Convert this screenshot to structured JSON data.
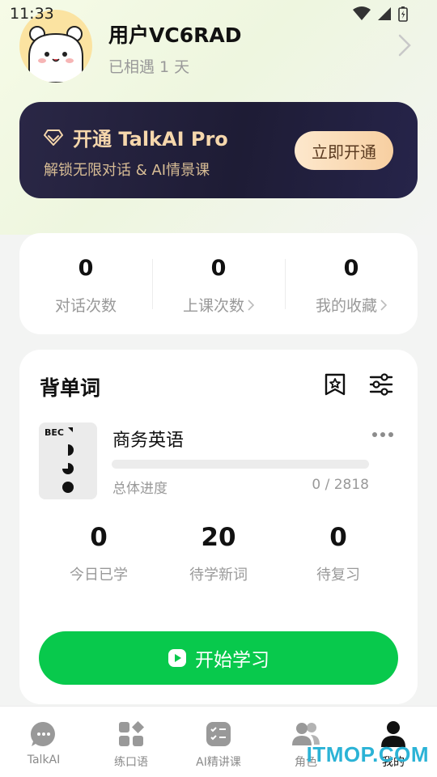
{
  "status_bar": {
    "time": "11:33"
  },
  "profile": {
    "username": "用户VC6RAD",
    "met_days": "已相遇 1 天"
  },
  "pro_card": {
    "title": "开通 TalkAI Pro",
    "subtitle": "解锁无限对话 & AI情景课",
    "button": "立即开通"
  },
  "stats": [
    {
      "value": "0",
      "label": "对话次数",
      "has_chevron": false
    },
    {
      "value": "0",
      "label": "上课次数",
      "has_chevron": true
    },
    {
      "value": "0",
      "label": "我的收藏",
      "has_chevron": true
    }
  ],
  "vocab": {
    "title": "背单词",
    "book": {
      "badge": "BEC",
      "name": "商务英语"
    },
    "progress": {
      "label": "总体进度",
      "learned": 0,
      "total": 2818,
      "text": "0 / 2818",
      "fraction": 0
    },
    "stats": [
      {
        "value": "0",
        "label": "今日已学"
      },
      {
        "value": "20",
        "label": "待学新词"
      },
      {
        "value": "0",
        "label": "待复习"
      }
    ],
    "start_button": "开始学习"
  },
  "tabs": [
    {
      "label": "TalkAI",
      "icon": "chat-bubble-icon"
    },
    {
      "label": "练口语",
      "icon": "grid-icon"
    },
    {
      "label": "AI精讲课",
      "icon": "checklist-icon"
    },
    {
      "label": "角色",
      "icon": "users-icon"
    },
    {
      "label": "我的",
      "icon": "user-icon",
      "active": true
    }
  ],
  "watermark": "ITMOP.COM",
  "colors": {
    "accent": "#08c94c",
    "pro_bg": "#1e1c35",
    "pro_gold": "#f6d7ac",
    "watermark": "#2bb3d6"
  }
}
